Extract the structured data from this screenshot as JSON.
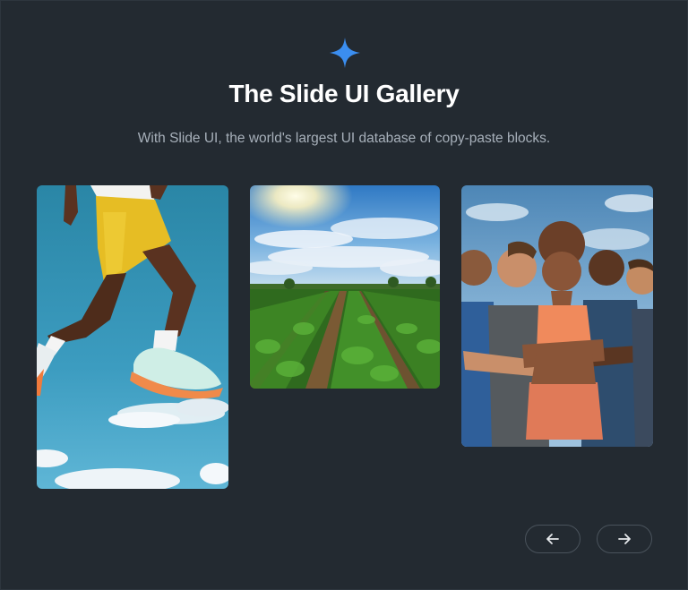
{
  "header": {
    "logo_icon": "sparkle-star-icon",
    "title": "The Slide UI Gallery",
    "subtitle": "With Slide UI, the world's largest UI database of copy-paste blocks."
  },
  "gallery": {
    "images": [
      {
        "subject": "jumping-runner",
        "alt": ""
      },
      {
        "subject": "crop-field",
        "alt": ""
      },
      {
        "subject": "group-of-athletes",
        "alt": ""
      }
    ]
  },
  "navigation": {
    "prev_icon": "arrow-left-icon",
    "next_icon": "arrow-right-icon"
  },
  "colors": {
    "background": "#232a31",
    "accent": "#3b8ef0",
    "title": "#ffffff",
    "subtitle": "#a7b0ba",
    "button_border": "#4a535c"
  }
}
